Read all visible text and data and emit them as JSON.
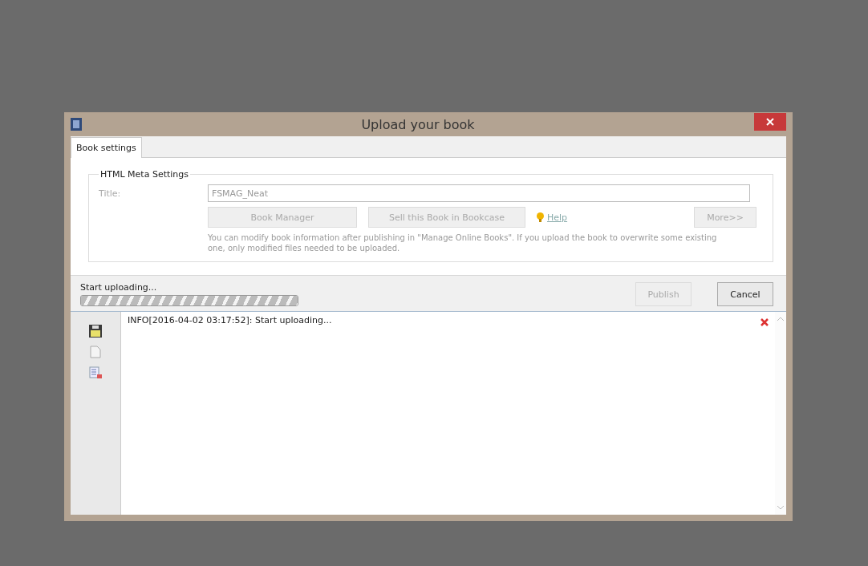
{
  "window": {
    "title": "Upload your book"
  },
  "tabs": [
    {
      "label": "Book settings",
      "selected": true
    }
  ],
  "group": {
    "title": "HTML Meta Settings",
    "field_label": "Title:",
    "field_value": "FSMAG_Neat",
    "field_disabled": true,
    "buttons": [
      {
        "label": "Book Manager",
        "disabled": true
      },
      {
        "label": "Sell this Book in Bookcase",
        "disabled": true
      }
    ],
    "help_link": "Help",
    "more_button": {
      "label": "More>>",
      "disabled": true
    },
    "note": "You can modify book information after publishing in \"Manage Online Books\". If you upload the book to overwrite some existing one, only modified files needed to be uploaded."
  },
  "status": {
    "text": "Start uploading...",
    "level": 1
  },
  "actions": [
    {
      "label": "Publish",
      "disabled": true
    },
    {
      "label": "Cancel",
      "disabled": false
    }
  ],
  "log": {
    "lines": [
      "INFO[2016-04-02 03:17:52]: Start uploading..."
    ]
  }
}
